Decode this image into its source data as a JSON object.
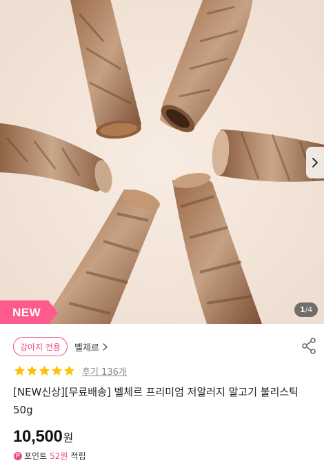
{
  "image": {
    "alt": "육포 스틱 제품 사진",
    "background_color": "#f3e6dc",
    "next_icon": "chevron-right-icon"
  },
  "badge": {
    "label": "NEW",
    "color": "#ff5a8c"
  },
  "pager": {
    "current": "1",
    "separator": "/",
    "total": "4"
  },
  "category_tag": {
    "label": "강아지 전용",
    "color": "#ec4f7b"
  },
  "brand": {
    "name": "벨체르",
    "icon": "chevron-right-icon"
  },
  "share": {
    "icon": "share-icon"
  },
  "rating": {
    "stars": 5,
    "max": 5,
    "star_color": "#ffc107",
    "review_label": "후기 136개"
  },
  "product": {
    "title": "[NEW신상][무료배송] 벨체르 프리미엄 저알러지 말고기 불리스틱 50g"
  },
  "price": {
    "amount": "10,500",
    "unit": "원"
  },
  "points": {
    "icon_letter": "P",
    "label": "포인트",
    "amount": "52원",
    "suffix": "적립",
    "accent": "#ec4f7b"
  }
}
